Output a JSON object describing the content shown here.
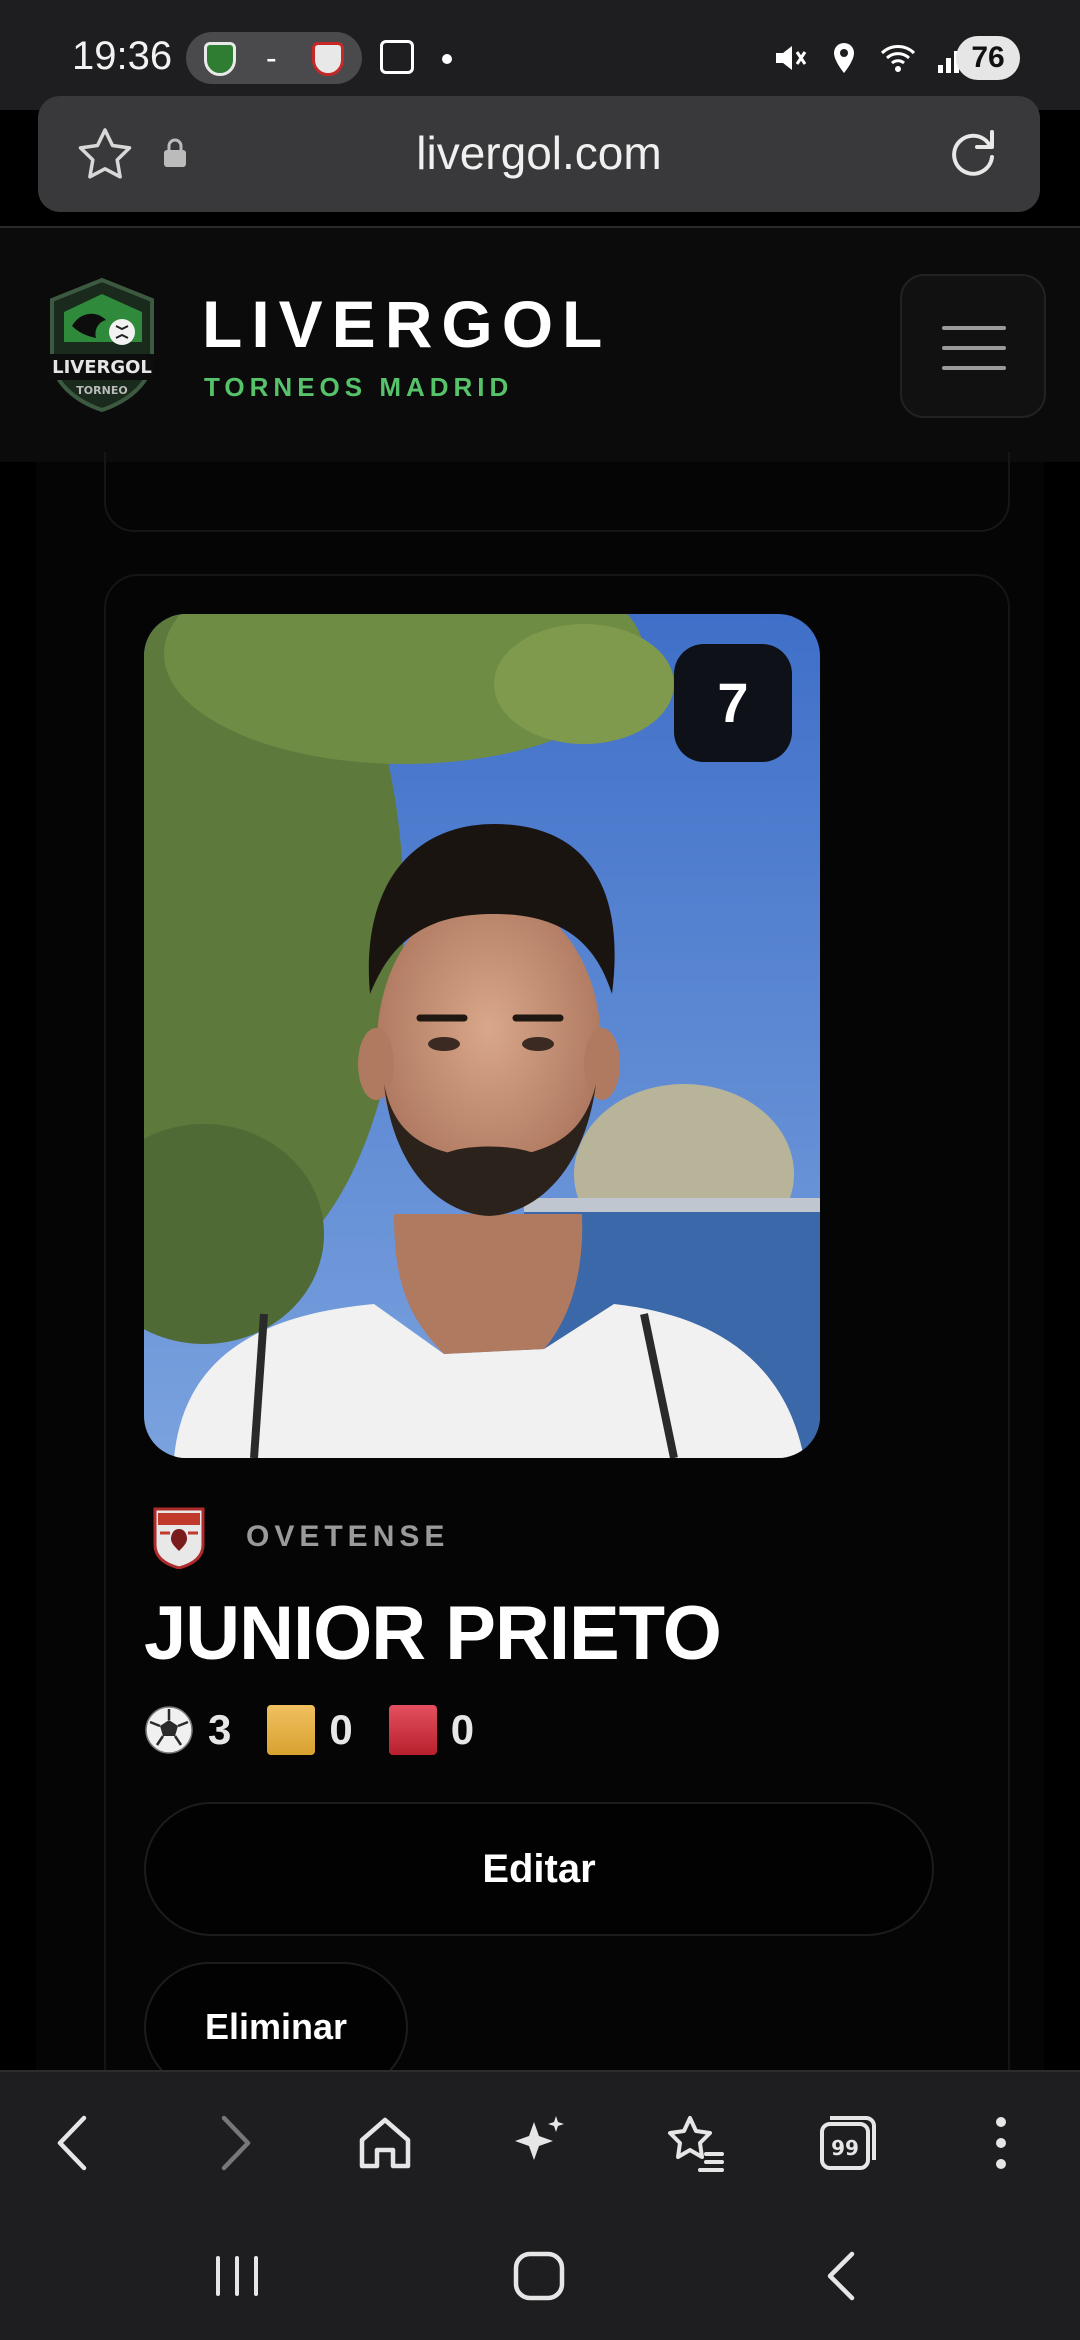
{
  "status_bar": {
    "time": "19:36",
    "match_separator": "-",
    "battery": "76",
    "icons": [
      "mute-icon",
      "location-icon",
      "wifi-icon",
      "signal-icon"
    ]
  },
  "browser": {
    "url": "livergol.com",
    "toolbar_icons": [
      "back-icon",
      "forward-icon",
      "home-icon",
      "sparkle-icon",
      "bookmarks-icon",
      "tabs-icon",
      "more-icon"
    ],
    "tabs_count": "99"
  },
  "site": {
    "logo_text": "LIVERGOL",
    "logo_subtext": "TORNEO",
    "title": "LIVERGOL",
    "subtitle": "TORNEOS MADRID",
    "accent": "#56c26a"
  },
  "player": {
    "number": "7",
    "team": "OVETENSE",
    "name": "JUNIOR PRIETO",
    "stats": {
      "goals": "3",
      "yellow_cards": "0",
      "red_cards": "0"
    }
  },
  "actions": {
    "edit": "Editar",
    "delete": "Eliminar"
  }
}
